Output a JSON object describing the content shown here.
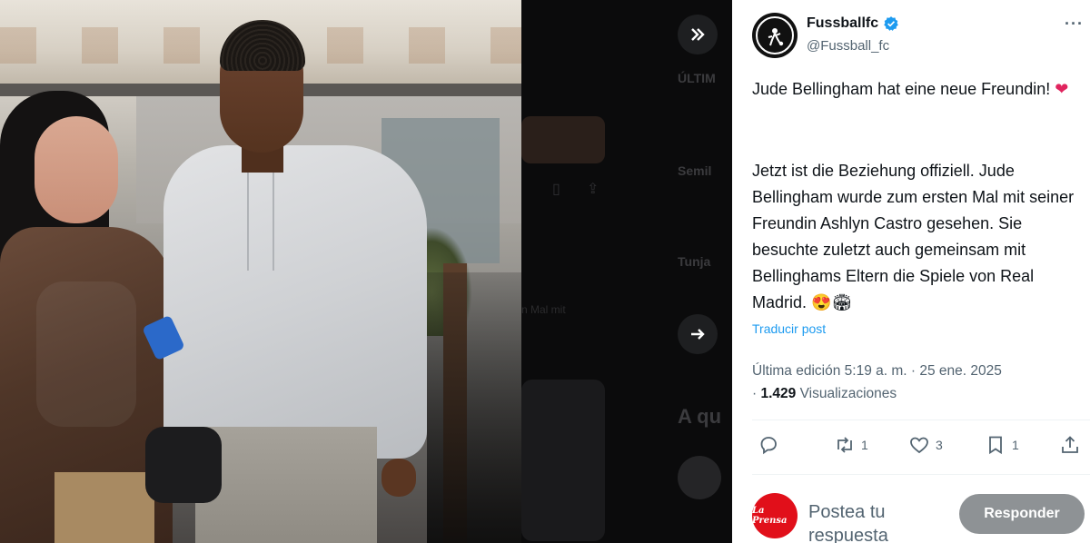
{
  "photo": {
    "alt": "photo"
  },
  "backdrop": {
    "text_1": "ÚLTIM",
    "text_2": "Semil",
    "text_3": "Tunja",
    "text_4": "n Mal mit",
    "text_5": "A qu",
    "expand_icon": "double-chevron-right-icon",
    "next_icon": "arrow-right-icon"
  },
  "tweet": {
    "author_name": "Fussballfc",
    "author_handle": "@Fussball_fc",
    "verified": true,
    "more_label": "···",
    "paragraph_1": "Jude Bellingham hat eine neue Freundin! ",
    "paragraph_1_emoji": "❤",
    "paragraph_2": "Jetzt ist die Beziehung offiziell. Jude Bellingham wurde zum ersten Mal mit seiner Freundin Ashlyn Castro gesehen. Sie besuchte zuletzt auch gemeinsam mit Bellinghams Eltern die Spiele von Real Madrid. ",
    "paragraph_2_emoji": "😍🏟",
    "translate_label": "Traducir post",
    "edited_label": "Última edición 5:19 a. m. · 25 ene. 2025",
    "views_count": "1.429",
    "views_label": "Visualizaciones",
    "views_prefix": "·",
    "accent_color": "#1d9bf0"
  },
  "actions": {
    "reply_count": "",
    "retweet_count": "1",
    "like_count": "3",
    "bookmark_count": "1"
  },
  "reply_box": {
    "avatar_text": "La Prensa",
    "placeholder": "Postea tu respuesta",
    "button_label": "Responder"
  }
}
